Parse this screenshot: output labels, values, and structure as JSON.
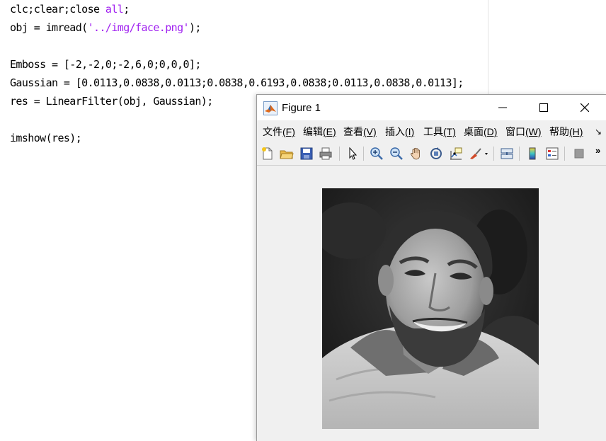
{
  "editor": {
    "lines": [
      {
        "segments": [
          "clc;clear;close ",
          "all",
          ";"
        ]
      },
      {
        "segments": [
          "obj = imread(",
          "'../img/face.png'",
          ");"
        ]
      },
      {
        "segments": [
          "",
          "",
          ""
        ]
      },
      {
        "segments": [
          "Emboss = [-2,-2,0;-2,6,0;0,0,0];",
          "",
          ""
        ]
      },
      {
        "segments": [
          "Gaussian = [0.0113,0.0838,0.0113;0.0838,0.6193,0.0838;0.0113,0.0838,0.0113];",
          "",
          ""
        ]
      },
      {
        "segments": [
          "res = LinearFilter(obj, Gaussian);",
          "",
          ""
        ]
      },
      {
        "segments": [
          "",
          "",
          ""
        ]
      },
      {
        "segments": [
          "imshow(res);",
          "",
          ""
        ]
      }
    ],
    "string_color": "#a020f0"
  },
  "figure": {
    "title": "Figure 1",
    "menu": [
      {
        "label": "文件",
        "accel": "(F)"
      },
      {
        "label": "编辑",
        "accel": "(E)"
      },
      {
        "label": "查看",
        "accel": "(V)"
      },
      {
        "label": "插入",
        "accel": "(I)"
      },
      {
        "label": "工具",
        "accel": "(T)"
      },
      {
        "label": "桌面",
        "accel": "(D)"
      },
      {
        "label": "窗口",
        "accel": "(W)"
      },
      {
        "label": "帮助",
        "accel": "(H)"
      }
    ],
    "more_menu_glyph": "↘",
    "toolbar_more_glyph": "»",
    "toolbar_icons": [
      "new-figure-icon",
      "open-file-icon",
      "save-icon",
      "print-icon",
      "pointer-icon",
      "zoom-in-icon",
      "zoom-out-icon",
      "pan-hand-icon",
      "rotate-3d-icon",
      "data-cursor-icon",
      "brush-icon",
      "link-plot-icon",
      "colorbar-icon",
      "legend-icon",
      "property-editor-icon"
    ],
    "window_buttons": [
      "minimize",
      "maximize",
      "close"
    ],
    "image_content": "grayscale photo of smiling bearded man"
  }
}
